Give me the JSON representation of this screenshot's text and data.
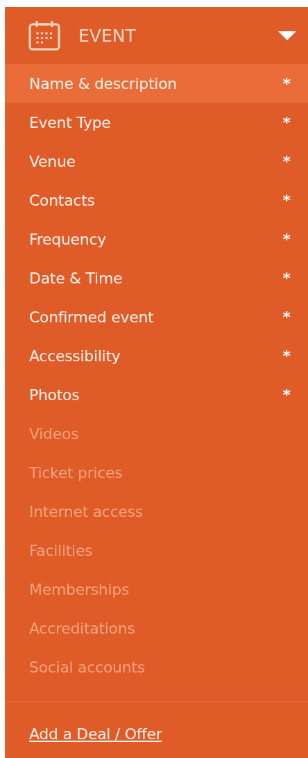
{
  "section": {
    "title": "EVENT",
    "expanded": true
  },
  "items": [
    {
      "label": "Name & description",
      "marker": "*",
      "enabled": true,
      "selected": true
    },
    {
      "label": "Event Type",
      "marker": "*",
      "enabled": true,
      "selected": false
    },
    {
      "label": "Venue",
      "marker": "*",
      "enabled": true,
      "selected": false
    },
    {
      "label": "Contacts",
      "marker": "*",
      "enabled": true,
      "selected": false
    },
    {
      "label": "Frequency",
      "marker": "*",
      "enabled": true,
      "selected": false
    },
    {
      "label": "Date & Time",
      "marker": "*",
      "enabled": true,
      "selected": false
    },
    {
      "label": "Confirmed event",
      "marker": "*",
      "enabled": true,
      "selected": false
    },
    {
      "label": "Accessibility",
      "marker": "*",
      "enabled": true,
      "selected": false
    },
    {
      "label": "Photos",
      "marker": "*",
      "enabled": true,
      "selected": false
    },
    {
      "label": "Videos",
      "enabled": false,
      "selected": false
    },
    {
      "label": "Ticket prices",
      "enabled": false,
      "selected": false
    },
    {
      "label": "Internet access",
      "enabled": false,
      "selected": false
    },
    {
      "label": "Facilities",
      "enabled": false,
      "selected": false
    },
    {
      "label": "Memberships",
      "enabled": false,
      "selected": false
    },
    {
      "label": "Accreditations",
      "enabled": false,
      "selected": false
    },
    {
      "label": "Social accounts",
      "enabled": false,
      "selected": false
    }
  ],
  "footer_link": "Add a Deal / Offer"
}
